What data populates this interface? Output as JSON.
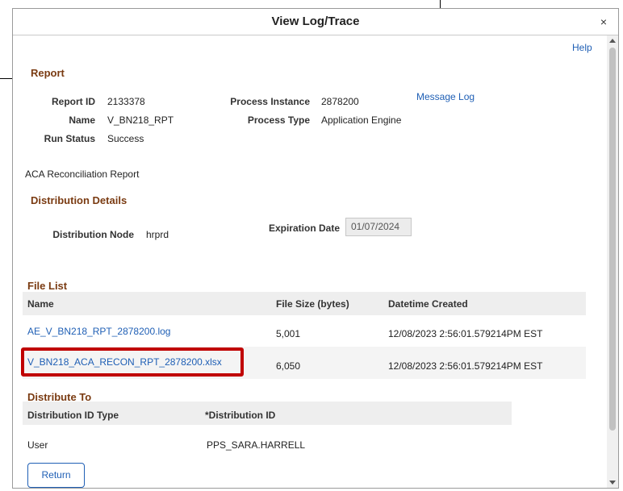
{
  "modal": {
    "title": "View Log/Trace",
    "close_glyph": "×",
    "help_label": "Help"
  },
  "report": {
    "heading": "Report",
    "report_id_label": "Report ID",
    "report_id": "2133378",
    "name_label": "Name",
    "name": "V_BN218_RPT",
    "run_status_label": "Run Status",
    "run_status": "Success",
    "process_instance_label": "Process Instance",
    "process_instance": "2878200",
    "process_type_label": "Process Type",
    "process_type": "Application Engine",
    "message_log_label": "Message Log",
    "description": "ACA Reconciliation Report"
  },
  "distribution_details": {
    "heading": "Distribution Details",
    "node_label": "Distribution Node",
    "node": "hrprd",
    "expiration_label": "Expiration Date",
    "expiration_date": "01/07/2024"
  },
  "file_list": {
    "heading": "File List",
    "columns": [
      "Name",
      "File Size (bytes)",
      "Datetime Created"
    ],
    "rows": [
      {
        "name": "AE_V_BN218_RPT_2878200.log",
        "size": "5,001",
        "created": "12/08/2023  2:56:01.579214PM EST"
      },
      {
        "name": "V_BN218_ACA_RECON_RPT_2878200.xlsx",
        "size": "6,050",
        "created": "12/08/2023  2:56:01.579214PM EST"
      }
    ]
  },
  "distribute_to": {
    "heading": "Distribute To",
    "columns": [
      "Distribution ID Type",
      "*Distribution ID"
    ],
    "rows": [
      {
        "type": "User",
        "id": "PPS_SARA.HARRELL"
      }
    ]
  },
  "actions": {
    "return_label": "Return"
  },
  "colors": {
    "section_heading": "#7a3b12",
    "link": "#1f5fb5",
    "highlight": "#c00000"
  }
}
